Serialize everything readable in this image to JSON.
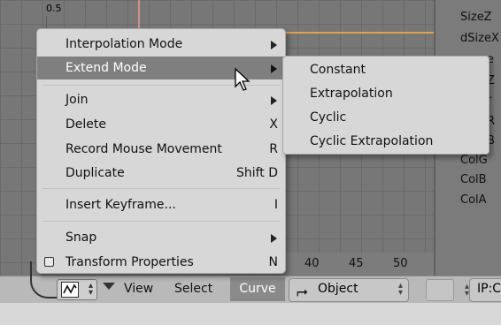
{
  "graph": {
    "y_tick": "0.5",
    "x_ticks": [
      "40",
      "45",
      "50"
    ]
  },
  "channels": [
    "SizeZ",
    "dSizeX",
    "e",
    "Z",
    "r",
    "B",
    "R",
    "ColG",
    "ColB",
    "ColA"
  ],
  "menu": {
    "items": [
      {
        "label": "Interpolation Mode",
        "shortcut": "",
        "submenu": true
      },
      {
        "label": "Extend Mode",
        "shortcut": "",
        "submenu": true,
        "highlighted": true
      },
      {
        "label": "Join",
        "shortcut": "",
        "submenu": true
      },
      {
        "label": "Delete",
        "shortcut": "X"
      },
      {
        "label": "Record Mouse Movement",
        "shortcut": "R"
      },
      {
        "label": "Duplicate",
        "shortcut": "Shift D"
      },
      {
        "label": "Insert Keyframe...",
        "shortcut": "I"
      },
      {
        "label": "Snap",
        "shortcut": "",
        "submenu": true
      },
      {
        "label": "Transform Properties",
        "shortcut": "N",
        "checkbox": true
      }
    ]
  },
  "submenu": {
    "items": [
      "Constant",
      "Extrapolation",
      "Cyclic",
      "Cyclic Extrapolation"
    ]
  },
  "toolbar": {
    "view": "View",
    "select": "Select",
    "curve": "Curve",
    "object": "Object",
    "ipo_block": "IP:C"
  },
  "colors": {
    "highlight": "#7f7f7f",
    "menu_bg": "#d7d7d7",
    "grid_bg": "#777777"
  }
}
